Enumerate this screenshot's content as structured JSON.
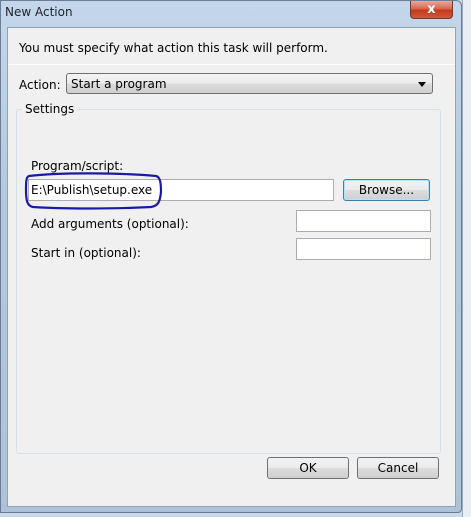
{
  "window": {
    "title": "New Action",
    "close_symbol": "x"
  },
  "instruction": "You must specify what action this task will perform.",
  "action": {
    "label": "Action:",
    "selected": "Start a program"
  },
  "settings": {
    "legend": "Settings",
    "program_label": "Program/script:",
    "program_value": "E:\\Publish\\setup.exe",
    "browse_label": "Browse...",
    "args_label": "Add arguments (optional):",
    "args_value": "",
    "start_label": "Start in (optional):",
    "start_value": ""
  },
  "footer": {
    "ok_label": "OK",
    "cancel_label": "Cancel"
  },
  "colors": {
    "annotation": "#1a1aa6"
  }
}
